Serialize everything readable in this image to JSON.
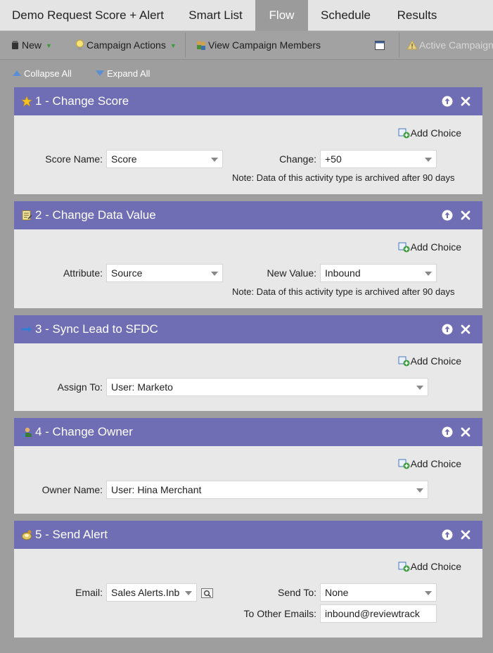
{
  "tabs": [
    {
      "label": "Demo Request Score + Alert",
      "active": false
    },
    {
      "label": "Smart List",
      "active": false
    },
    {
      "label": "Flow",
      "active": true
    },
    {
      "label": "Schedule",
      "active": false
    },
    {
      "label": "Results",
      "active": false
    }
  ],
  "toolbar": {
    "new_label": "New",
    "campaign_actions_label": "Campaign Actions",
    "view_members_label": "View Campaign Members",
    "active_campaign_label": "Active Campaign"
  },
  "flow_controls": {
    "collapse_all": "Collapse All",
    "expand_all": "Expand All"
  },
  "add_choice_label": "Add Choice",
  "steps": [
    {
      "title": "1 - Change Score",
      "icon": "star-icon",
      "fields": {
        "score_name_label": "Score Name:",
        "score_name_value": "Score",
        "change_label": "Change:",
        "change_value": "+50"
      },
      "note": "Note: Data of this activity type is archived after 90 days"
    },
    {
      "title": "2 - Change Data Value",
      "icon": "notepad-icon",
      "fields": {
        "attribute_label": "Attribute:",
        "attribute_value": "Source",
        "new_value_label": "New Value:",
        "new_value_value": "Inbound"
      },
      "note": "Note: Data of this activity type is archived after 90 days"
    },
    {
      "title": "3 - Sync Lead to SFDC",
      "icon": "sync-arrow-icon",
      "fields": {
        "assign_to_label": "Assign To:",
        "assign_to_value": "User: Marketo"
      }
    },
    {
      "title": "4 - Change Owner",
      "icon": "owner-person-icon",
      "fields": {
        "owner_name_label": "Owner Name:",
        "owner_name_value": "User: Hina Merchant"
      }
    },
    {
      "title": "5 - Send Alert",
      "icon": "alert-bell-icon",
      "fields": {
        "email_label": "Email:",
        "email_value": "Sales Alerts.Inb",
        "send_to_label": "Send To:",
        "send_to_value": "None",
        "other_emails_label": "To Other Emails:",
        "other_emails_value": "inbound@reviewtrack"
      }
    }
  ],
  "colors": {
    "step_header": "#6f6db3",
    "body_bg": "#9e9e9e",
    "step_body": "#e8e8e8",
    "active_tab": "#9b9b9b"
  }
}
